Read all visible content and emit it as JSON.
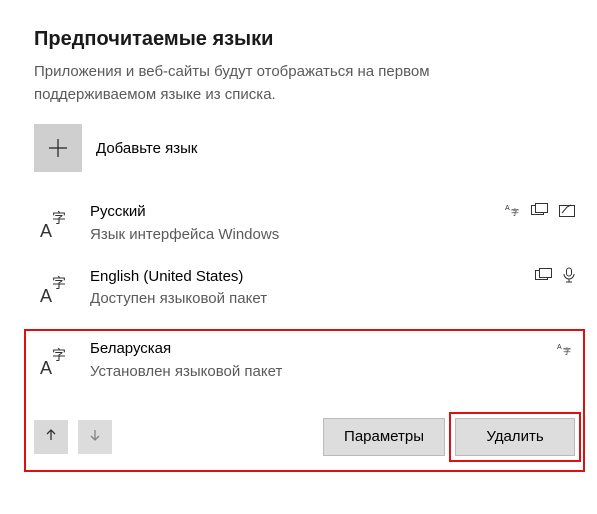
{
  "section": {
    "title": "Предпочитаемые языки",
    "description": "Приложения и веб-сайты будут отображаться на первом поддерживаемом языке из списка."
  },
  "add": {
    "label": "Добавьте язык"
  },
  "languages": [
    {
      "name": "Русский",
      "sub": "Язык интерфейса Windows"
    },
    {
      "name": "English (United States)",
      "sub": "Доступен языковой пакет"
    },
    {
      "name": "Беларуская",
      "sub": "Установлен языковой пакет"
    }
  ],
  "actions": {
    "options": "Параметры",
    "remove": "Удалить"
  },
  "colors": {
    "highlight": "#d11"
  }
}
